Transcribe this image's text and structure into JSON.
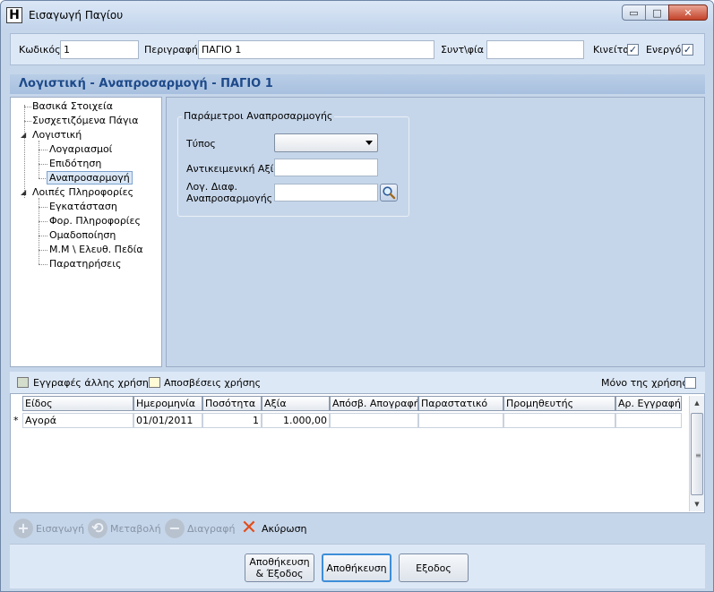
{
  "window": {
    "title": "Εισαγωγή Παγίου",
    "app_icon_letter": "H",
    "controls": {
      "minimize": "▭",
      "maximize": "□",
      "close": "✕"
    }
  },
  "header_fields": {
    "code_label": "Κωδικός",
    "code_value": "1",
    "description_label": "Περιγραφή",
    "description_value": "ΠΑΓΙΟ 1",
    "conversion_label": "Συντ\\φία",
    "conversion_value": "",
    "moving_label": "Κινείται",
    "moving_checked": true,
    "active_label": "Ενεργό",
    "active_checked": true
  },
  "section": {
    "title": "Λογιστική - Αναπροσαρμογή - ΠΑΓΙΟ 1"
  },
  "tree": {
    "items": [
      {
        "label": "Βασικά Στοιχεία"
      },
      {
        "label": "Συσχετιζόμενα Πάγια"
      },
      {
        "label": "Λογιστική"
      },
      {
        "label": "Λογαριασμοί"
      },
      {
        "label": "Επιδότηση"
      },
      {
        "label": "Αναπροσαρμογή"
      },
      {
        "label": "Λοιπές Πληροφορίες"
      },
      {
        "label": "Εγκατάσταση"
      },
      {
        "label": "Φορ. Πληροφορίες"
      },
      {
        "label": "Ομαδοποίηση"
      },
      {
        "label": "Μ.Μ \\ Ελευθ. Πεδία"
      },
      {
        "label": "Παρατηρήσεις"
      }
    ]
  },
  "revaluation": {
    "group_title": "Παράμετροι Αναπροσαρμογής",
    "type_label": "Τύπος",
    "type_value": "",
    "objective_value_label": "Αντικειμενική Αξία",
    "objective_value": "",
    "account_label_line1": "Λογ. Διαφ.",
    "account_label_line2": "Αναπροσαρμογής",
    "account_value": ""
  },
  "legend": {
    "other_year_label": "Εγγραφές άλλης χρήσης",
    "other_year_color": "#d4dccb",
    "depreciation_label": "Αποσβέσεις χρήσης",
    "depreciation_color": "#fffbd6",
    "only_year_label": "Μόνο της χρήσης",
    "only_year_checked": false
  },
  "grid": {
    "columns": [
      "Είδος",
      "Ημερομηνία",
      "Ποσότητα",
      "Αξία",
      "Απόσβ. Απογραφής",
      "Παραστατικό",
      "Προμηθευτής",
      "Αρ. Εγγραφής"
    ],
    "row_marker": "*",
    "rows": [
      {
        "type": "Αγορά",
        "date": "01/01/2011",
        "quantity": "1",
        "value": "1.000,00",
        "depreciation": "",
        "document": "",
        "supplier": "",
        "entry_no": ""
      }
    ],
    "scroll": {
      "up": "▲",
      "down": "▼",
      "grip": "≡"
    }
  },
  "actions": {
    "insert": "Εισαγωγή",
    "insert_icon": "+",
    "modify": "Μεταβολή",
    "modify_icon": "⟲",
    "delete": "Διαγραφή",
    "delete_icon": "−",
    "cancel": "Ακύρωση",
    "cancel_icon": "✕"
  },
  "buttons": {
    "save_exit_line1": "Αποθήκευση",
    "save_exit_line2": "& Έξοδος",
    "save": "Αποθήκευση",
    "exit": "Εξοδος"
  },
  "colors": {
    "accent": "#1e4a8a",
    "panel": "#c6d6ea",
    "cancel_icon": "#e24d1d"
  }
}
